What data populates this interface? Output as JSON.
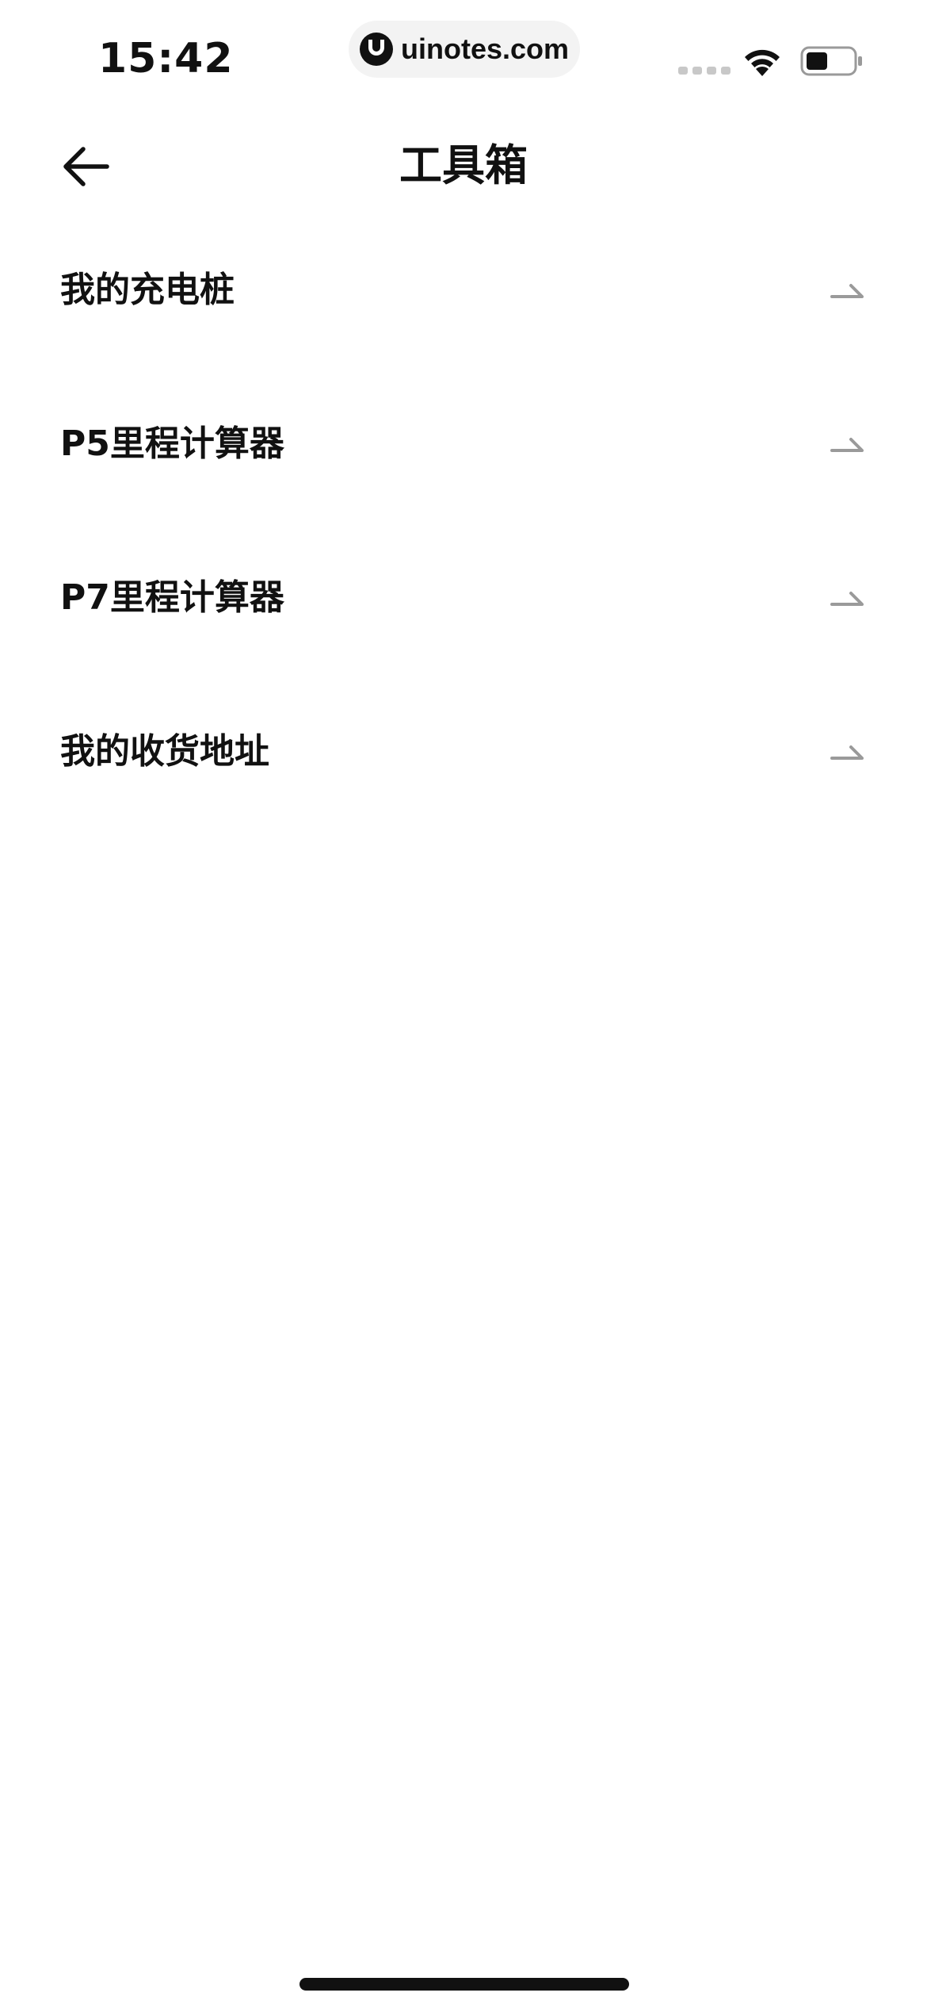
{
  "status_bar": {
    "time": "15:42",
    "watermark": "uinotes.com",
    "icons": [
      "signal-dots-icon",
      "wifi-icon",
      "battery-icon"
    ]
  },
  "nav": {
    "back_icon": "arrow-left-icon",
    "title": "工具箱"
  },
  "menu": {
    "items": [
      {
        "label": "我的充电桩",
        "icon": "chevron-right-icon"
      },
      {
        "label": "P5里程计算器",
        "icon": "chevron-right-icon"
      },
      {
        "label": "P7里程计算器",
        "icon": "chevron-right-icon"
      },
      {
        "label": "我的收货地址",
        "icon": "chevron-right-icon"
      }
    ]
  },
  "colors": {
    "text": "#111111",
    "arrow": "#9a9a9a",
    "background": "#ffffff"
  }
}
